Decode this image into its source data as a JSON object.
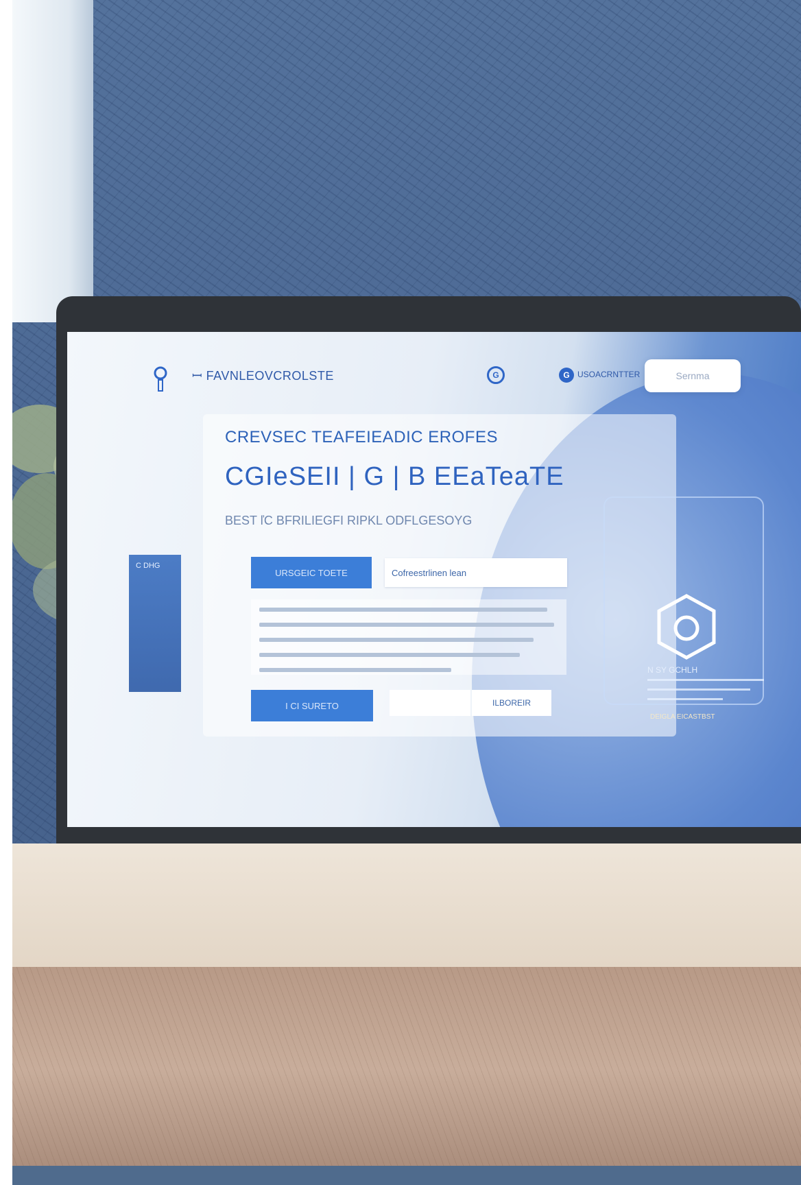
{
  "site": {
    "brand": "ꟷ FAVNLEOVCROLSTE",
    "nav_account_label": "USOACRNTTER",
    "nav_button_label": "Sernma"
  },
  "hero": {
    "eyebrow": "CREVSEC TEAFEIEADIC EROFES",
    "headline": "CGIeSEII | G | B EEaTeaTE",
    "subline": "BEST ľC BFRILIEGFI RIPKL ODFLGESOYG"
  },
  "actions": {
    "primary_label": "URSGEIC TOETE",
    "field_value": "Cofreestrlinen lean",
    "primary2_label": "I CI SURETO",
    "secondary_label": "ILBOREIR"
  },
  "side_panel": {
    "label": "C DHG"
  },
  "phone": {
    "label": "N SY GCHLH",
    "cta": "DEIGLA EICASTBST"
  },
  "colors": {
    "accent": "#3c7ed8",
    "brand_text": "#2f63bf",
    "wall": "#4d6a95",
    "laptop_bezel": "#2f3338"
  },
  "icons": {
    "logo": "pin-logo-icon",
    "nav": "circle-g-icon",
    "account": "account-icon",
    "hex": "hexagon-logo-icon"
  }
}
